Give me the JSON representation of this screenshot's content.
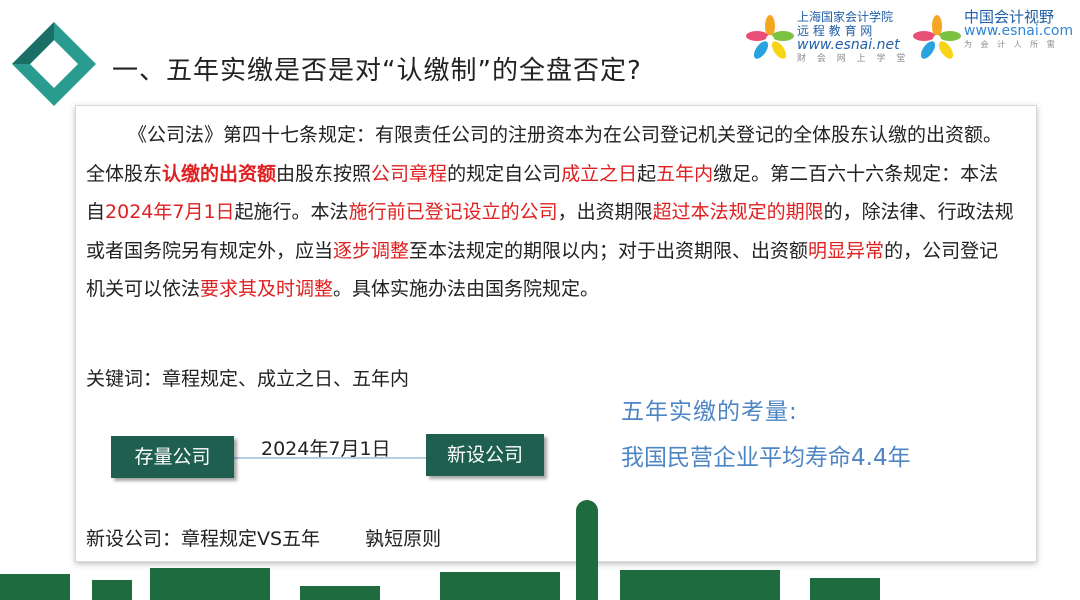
{
  "header": {
    "title": "一、五年实缴是否是对“认缴制”的全盘否定?"
  },
  "brand_left": {
    "line1": "上海国家会计学院",
    "line2": "远 程 教 育 网",
    "url": "www.esnai.net",
    "sub": "财 会 网 上 学 堂"
  },
  "brand_right": {
    "name": "中国会计视野",
    "url": "www.esnai.com",
    "sub": "为 会 计 人 所 需"
  },
  "law": {
    "segments": [
      {
        "text": "《公司法》第四十七条规定：有限责任公司的注册资本为在公司登记机关登记的全体股东认缴的出资额。全体股东",
        "style": "normal"
      },
      {
        "text": "认缴的出资额",
        "style": "red-bold"
      },
      {
        "text": "由股东按照",
        "style": "normal"
      },
      {
        "text": "公司章程",
        "style": "red"
      },
      {
        "text": "的规定自公司",
        "style": "normal"
      },
      {
        "text": "成立之日",
        "style": "red"
      },
      {
        "text": "起",
        "style": "normal"
      },
      {
        "text": "五年内",
        "style": "red"
      },
      {
        "text": "缴足。第二百六十六条规定：本法自",
        "style": "normal"
      },
      {
        "text": "2024年7月1日",
        "style": "red"
      },
      {
        "text": "起施行。本法",
        "style": "normal"
      },
      {
        "text": "施行前已登记设立的公司",
        "style": "red"
      },
      {
        "text": "，出资期限",
        "style": "normal"
      },
      {
        "text": "超过本法规定的期限",
        "style": "red"
      },
      {
        "text": "的，除法律、行政法规或者国务院另有规定外，应当",
        "style": "normal"
      },
      {
        "text": "逐步调整",
        "style": "red"
      },
      {
        "text": "至本法规定的期限以内；对于出资期限、出资额",
        "style": "normal"
      },
      {
        "text": "明显异常",
        "style": "red"
      },
      {
        "text": "的，公司登记机关可以依法",
        "style": "normal"
      },
      {
        "text": "要求其及时调整",
        "style": "red"
      },
      {
        "text": "。具体实施办法由国务院规定。",
        "style": "normal"
      }
    ]
  },
  "keywords": "关键词：章程规定、成立之日、五年内",
  "timeline": {
    "existing_label": "存量公司",
    "date": "2024年7月1日",
    "new_label": "新设公司"
  },
  "consideration": {
    "title": "五年实缴的考量:",
    "value": "我国民营企业平均寿命4.4年"
  },
  "bottom": {
    "left": "新设公司：章程规定VS五年",
    "right": "孰短原则"
  },
  "colors": {
    "accent_red": "#e02020",
    "box_green": "#1e5f4f",
    "consider_blue": "#4e86c4",
    "corner_teal": "#2a9b8f"
  }
}
